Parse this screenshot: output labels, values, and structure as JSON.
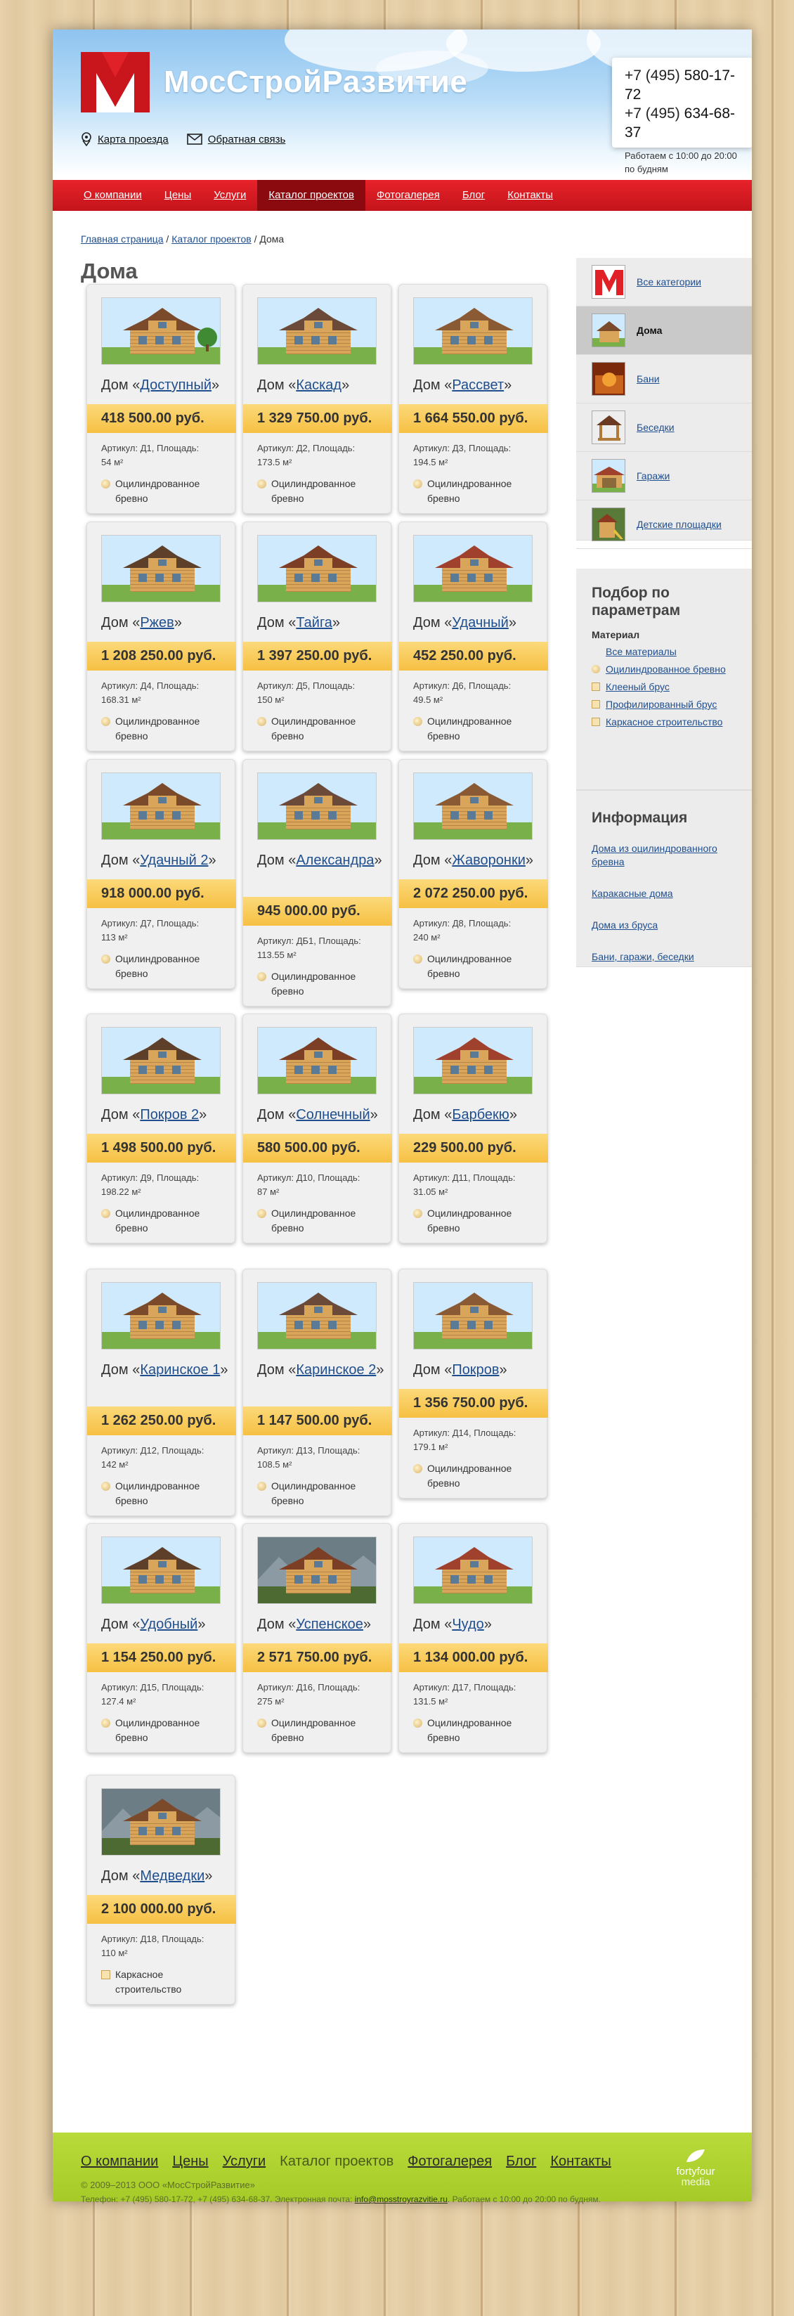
{
  "header": {
    "brand": "МосСтройРазвитие",
    "links": {
      "map": "Карта проезда",
      "feedback": "Обратная связь"
    },
    "phone1_code": "+7 (495)",
    "phone1_num": "580-17-72",
    "phone2_code": "+7 (495)",
    "phone2_num": "634-68-37",
    "hours": "Работаем с 10:00 до 20:00 по будням"
  },
  "nav": {
    "items": [
      "О компании",
      "Цены",
      "Услуги",
      "Каталог проектов",
      "Фотогалерея",
      "Блог",
      "Контакты"
    ],
    "active_index": 3
  },
  "breadcrumbs": {
    "home": "Главная страница",
    "sep": "/",
    "catalog": "Каталог проектов",
    "current": "Дома"
  },
  "page_title": "Дома",
  "products": [
    {
      "prefix": "Дом «",
      "name": "Доступный",
      "suffix": "»",
      "price": "418 500.00 руб.",
      "article": "Д1",
      "area": "54 м²",
      "material": "Оцилиндрованное бревно",
      "material_icon": "log-icon"
    },
    {
      "prefix": "Дом «",
      "name": "Каскад",
      "suffix": "»",
      "price": "1 329 750.00 руб.",
      "article": "Д2",
      "area": "173.5 м²",
      "material": "Оцилиндрованное бревно",
      "material_icon": "log-icon"
    },
    {
      "prefix": "Дом «",
      "name": "Рассвет",
      "suffix": "»",
      "price": "1 664 550.00 руб.",
      "article": "Д3",
      "area": "194.5 м²",
      "material": "Оцилиндрованное бревно",
      "material_icon": "log-icon"
    },
    {
      "prefix": "Дом «",
      "name": "Ржев",
      "suffix": "»",
      "price": "1 208 250.00 руб.",
      "article": "Д4",
      "area": "168.31 м²",
      "material": "Оцилиндрованное бревно",
      "material_icon": "log-icon"
    },
    {
      "prefix": "Дом «",
      "name": "Тайга",
      "suffix": "»",
      "price": "1 397 250.00 руб.",
      "article": "Д5",
      "area": "150 м²",
      "material": "Оцилиндрованное бревно",
      "material_icon": "log-icon"
    },
    {
      "prefix": "Дом «",
      "name": "Удачный",
      "suffix": "»",
      "price": "452 250.00 руб.",
      "article": "Д6",
      "area": "49.5 м²",
      "material": "Оцилиндрованное бревно",
      "material_icon": "log-icon"
    },
    {
      "prefix": "Дом «",
      "name": "Удачный 2",
      "suffix": "»",
      "price": "918 000.00 руб.",
      "article": "Д7",
      "area": "113 м²",
      "material": "Оцилиндрованное бревно",
      "material_icon": "log-icon"
    },
    {
      "prefix": "Дом «",
      "name": "Александра",
      "suffix": "»",
      "price": "945 000.00 руб.",
      "article": "ДБ1",
      "area": "113.55 м²",
      "material": "Оцилиндрованное бревно",
      "material_icon": "log-icon"
    },
    {
      "prefix": "Дом «",
      "name": "Жаворонки",
      "suffix": "»",
      "price": "2 072 250.00 руб.",
      "article": "Д8",
      "area": "240 м²",
      "material": "Оцилиндрованное бревно",
      "material_icon": "log-icon"
    },
    {
      "prefix": "Дом «",
      "name": "Покров 2",
      "suffix": "»",
      "price": "1 498 500.00 руб.",
      "article": "Д9",
      "area": "198.22 м²",
      "material": "Оцилиндрованное бревно",
      "material_icon": "log-icon"
    },
    {
      "prefix": "Дом «",
      "name": "Солнечный",
      "suffix": "»",
      "price": "580 500.00 руб.",
      "article": "Д10",
      "area": "87 м²",
      "material": "Оцилиндрованное бревно",
      "material_icon": "log-icon"
    },
    {
      "prefix": "Дом «",
      "name": "Барбекю",
      "suffix": "»",
      "price": "229 500.00 руб.",
      "article": "Д11",
      "area": "31.05 м²",
      "material": "Оцилиндрованное бревно",
      "material_icon": "log-icon"
    },
    {
      "prefix": "Дом «",
      "name": "Каринское 1",
      "suffix": "»",
      "price": "1 262 250.00 руб.",
      "article": "Д12",
      "area": "142 м²",
      "material": "Оцилиндрованное бревно",
      "material_icon": "log-icon"
    },
    {
      "prefix": "Дом «",
      "name": "Каринское 2",
      "suffix": "»",
      "price": "1 147 500.00 руб.",
      "article": "Д13",
      "area": "108.5 м²",
      "material": "Оцилиндрованное бревно",
      "material_icon": "log-icon"
    },
    {
      "prefix": "Дом «",
      "name": "Покров",
      "suffix": "»",
      "price": "1 356 750.00 руб.",
      "article": "Д14",
      "area": "179.1 м²",
      "material": "Оцилиндрованное бревно",
      "material_icon": "log-icon"
    },
    {
      "prefix": "Дом «",
      "name": "Удобный",
      "suffix": "»",
      "price": "1 154 250.00 руб.",
      "article": "Д15",
      "area": "127.4 м²",
      "material": "Оцилиндрованное бревно",
      "material_icon": "log-icon"
    },
    {
      "prefix": "Дом «",
      "name": "Успенское",
      "suffix": "»",
      "price": "2 571 750.00 руб.",
      "article": "Д16",
      "area": "275 м²",
      "material": "Оцилиндрованное бревно",
      "material_icon": "log-icon"
    },
    {
      "prefix": "Дом «",
      "name": "Чудо",
      "suffix": "»",
      "price": "1 134 000.00 руб.",
      "article": "Д17",
      "area": "131.5 м²",
      "material": "Оцилиндрованное бревно",
      "material_icon": "log-icon"
    },
    {
      "prefix": "Дом «",
      "name": "Медведки",
      "suffix": "»",
      "price": "2 100 000.00 руб.",
      "article": "Д18",
      "area": "110 м²",
      "material": "Каркасное строительство",
      "material_icon": "frame-icon"
    }
  ],
  "labels": {
    "article": "Артикул:",
    "area": "Площадь:"
  },
  "sidebar": {
    "categories": [
      {
        "label": "Все категории",
        "icon": "logo-icon"
      },
      {
        "label": "Дома",
        "icon": "house-icon"
      },
      {
        "label": "Бани",
        "icon": "sauna-icon"
      },
      {
        "label": "Беседки",
        "icon": "gazebo-icon"
      },
      {
        "label": "Гаражи",
        "icon": "garage-icon"
      },
      {
        "label": "Детские площадки",
        "icon": "playground-icon"
      }
    ],
    "active_index": 1,
    "filter_title": "Подбор по параметрам",
    "filter_subtitle": "Материал",
    "filters": [
      {
        "label": "Все материалы",
        "icon": ""
      },
      {
        "label": "Оцилиндрованное бревно",
        "icon": "log-icon"
      },
      {
        "label": "Клееный брус",
        "icon": "beam-icon"
      },
      {
        "label": "Профилированный брус",
        "icon": "beam-icon"
      },
      {
        "label": "Каркасное строительство",
        "icon": "frame-icon"
      }
    ],
    "info_title": "Информация",
    "info_links": [
      "Дома из оцилиндрованного бревна",
      "Каракасные дома",
      "Дома из бруса",
      "Бани, гаражи, беседки"
    ]
  },
  "footer": {
    "nav": [
      "О компании",
      "Цены",
      "Услуги",
      "Каталог проектов",
      "Фотогалерея",
      "Блог",
      "Контакты"
    ],
    "nav_current_index": 3,
    "copyright": "© 2009–2013 ООО «МосСтройРазвитие»",
    "contacts_text": "Телефон: +7 (495) 580-17-72, +7 (495) 634-68-37. Электронная почта:",
    "email": "info@mosstroyrazvitie.ru",
    "contacts_tail": ". Работаем с 10:00 до 20:00 по будням.",
    "studio_line1": "fortyfour",
    "studio_line2": "media"
  },
  "colors": {
    "accent_red": "#d91920",
    "price_yellow": "#f8c84c",
    "footer_green": "#b0d232",
    "link_blue": "#1f4f8f"
  }
}
